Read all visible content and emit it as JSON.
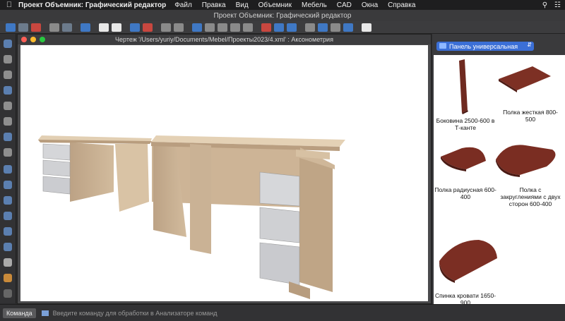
{
  "menubar": {
    "app_name": "Проект Объемник: Графический редактор",
    "items": [
      "Файл",
      "Правка",
      "Вид",
      "Объемник",
      "Мебель",
      "CAD",
      "Окна",
      "Справка"
    ]
  },
  "window": {
    "title": "Проект Объемник: Графический редактор"
  },
  "drawing": {
    "title": "Чертеж '/Users/yuriy/Documents/Mebel/Проекты2023/4.xml' : Аксонометрия"
  },
  "panel": {
    "selector": "Панель универсальная",
    "items": [
      {
        "label": "Боковина 2500-600 в Т-канте"
      },
      {
        "label": "Полка жесткая 800-500"
      },
      {
        "label": "Полка радиусная 600-400"
      },
      {
        "label": "Полка с закруглениями с двух сторон 600-400"
      },
      {
        "label": "Спинка кровати 1650-900"
      }
    ]
  },
  "status": {
    "command_label": "Команда",
    "command_placeholder": "Введите команду для обработки в Анализаторе команд"
  },
  "colors": {
    "wood_light": "#d9c4a8",
    "drawer_gray": "#c8c9cc",
    "part_brown": "#7a2b22",
    "accent_blue": "#3b6fd6"
  }
}
